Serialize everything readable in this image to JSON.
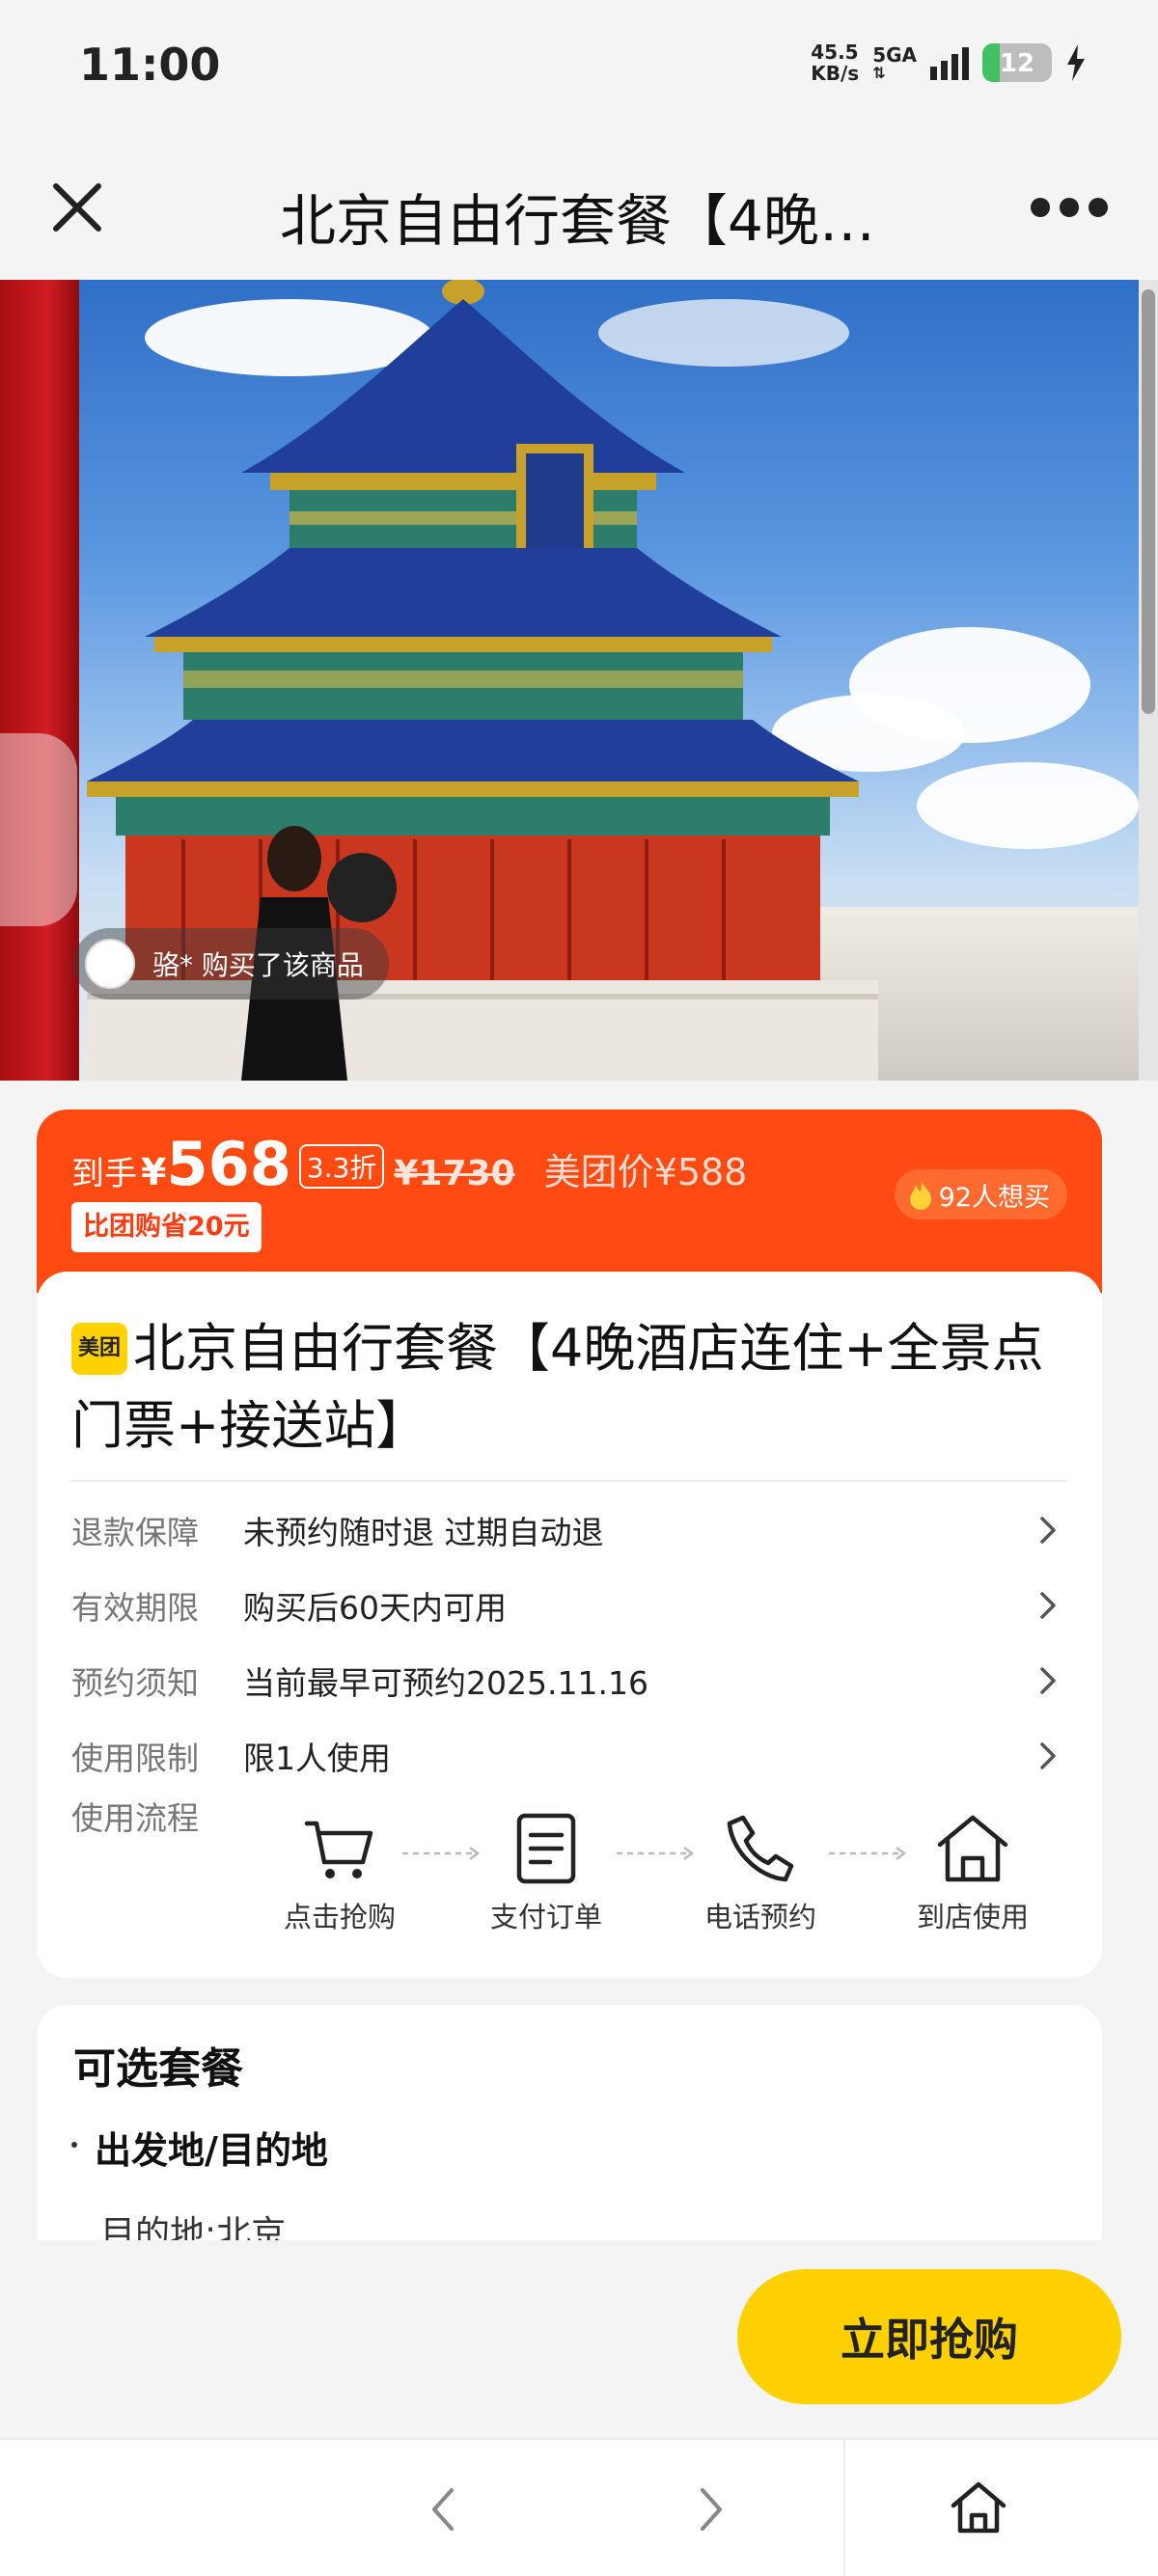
{
  "status_bar": {
    "time": "11:00",
    "speed_value": "45.5",
    "speed_unit": "KB/s",
    "network": "5GA",
    "battery": "12",
    "battery_level": 0.12
  },
  "nav": {
    "title": "北京自由行套餐【4晚…"
  },
  "hero": {
    "buyer_notice": "骆* 购买了该商品"
  },
  "price": {
    "prefix": "到手",
    "currency": "¥",
    "amount": "568",
    "discount": "3.3折",
    "original": "¥1730",
    "meituan_price": "美团价¥588",
    "save_tag": "比团购省20元",
    "want_count": "92人想买"
  },
  "product": {
    "logo_text": "美团",
    "title": "北京自由行套餐【4晚酒店连住+全景点门票+接送站】",
    "info": [
      {
        "label": "退款保障",
        "value": "未预约随时退 过期自动退"
      },
      {
        "label": "有效期限",
        "value": "购买后60天内可用"
      },
      {
        "label": "预约须知",
        "value": "当前最早可预约2025.11.16"
      },
      {
        "label": "使用限制",
        "value": "限1人使用"
      }
    ],
    "flow_label": "使用流程",
    "flow_steps": [
      {
        "label": "点击抢购",
        "icon": "cart-icon"
      },
      {
        "label": "支付订单",
        "icon": "document-icon"
      },
      {
        "label": "电话预约",
        "icon": "phone-icon"
      },
      {
        "label": "到店使用",
        "icon": "store-icon"
      }
    ]
  },
  "package": {
    "title": "可选套餐",
    "subtitle": "出发地/目的地",
    "destination": "目的地:北京"
  },
  "buy_button": "立即抢购",
  "colors": {
    "price_banner": "#ff4a12",
    "buy_button": "#ffd100",
    "meituan_yellow": "#ffd200"
  }
}
